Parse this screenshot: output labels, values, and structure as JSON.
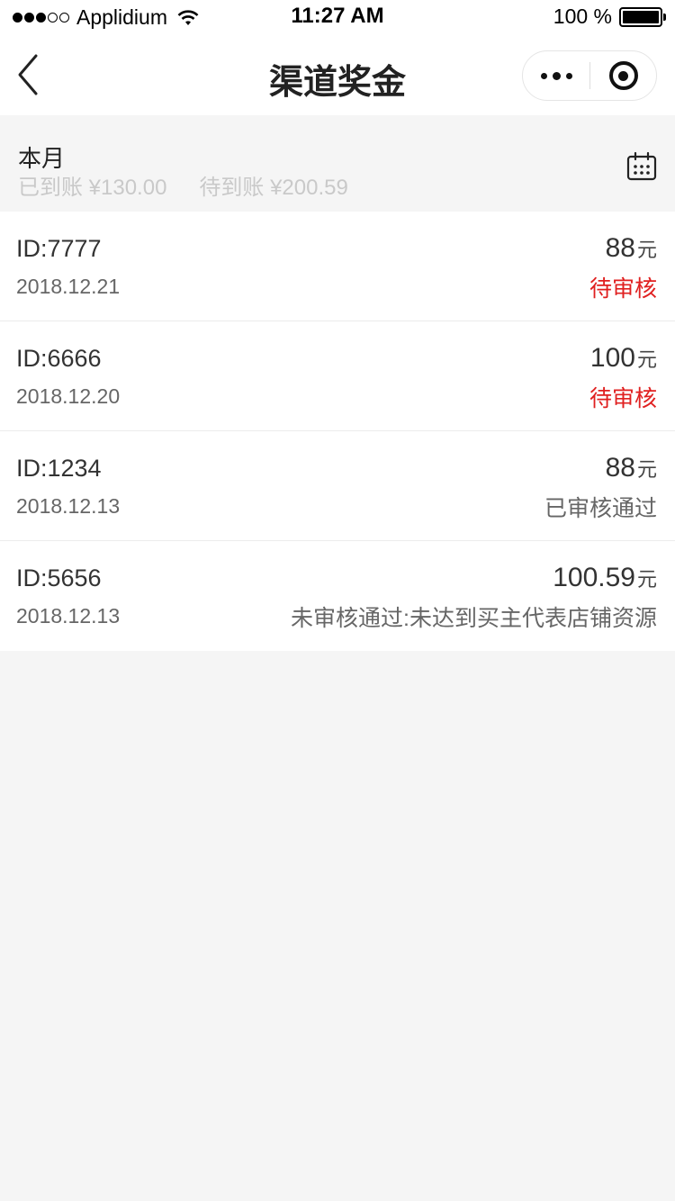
{
  "status_bar": {
    "carrier": "Applidium",
    "time": "11:27 AM",
    "battery": "100 %"
  },
  "nav": {
    "title": "渠道奖金"
  },
  "summary": {
    "period": "本月",
    "arrived": "已到账 ¥130.00",
    "pending": "待到账 ¥200.59"
  },
  "colors": {
    "pending_status": "#e02020",
    "normal_status": "#666666"
  },
  "records": [
    {
      "id": "ID:7777",
      "date": "2018.12.21",
      "amount": "88",
      "unit": "元",
      "status": "待审核",
      "status_color": "#e02020"
    },
    {
      "id": "ID:6666",
      "date": "2018.12.20",
      "amount": "100",
      "unit": "元",
      "status": "待审核",
      "status_color": "#e02020"
    },
    {
      "id": "ID:1234",
      "date": "2018.12.13",
      "amount": "88",
      "unit": "元",
      "status": "已审核通过",
      "status_color": "#666666"
    },
    {
      "id": "ID:5656",
      "date": "2018.12.13",
      "amount": "100.59",
      "unit": "元",
      "status": "未审核通过:未达到买主代表店铺资源",
      "status_color": "#666666"
    }
  ]
}
